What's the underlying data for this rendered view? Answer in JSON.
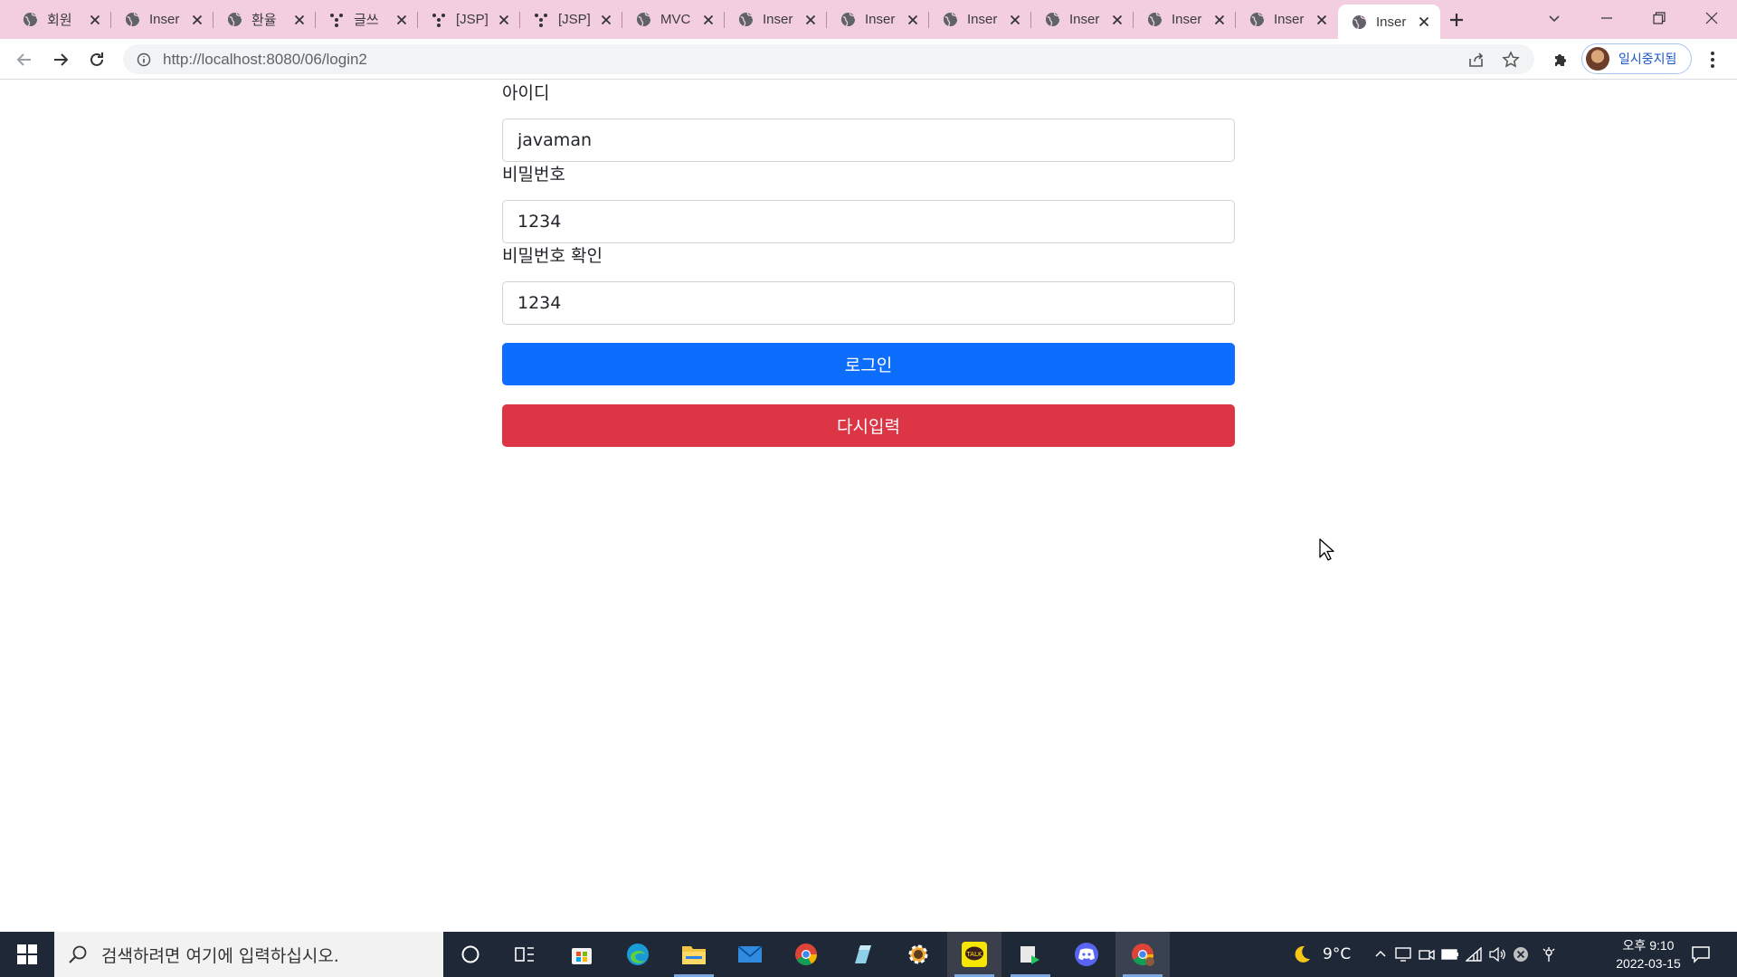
{
  "browser": {
    "tabs": [
      {
        "title": "회원",
        "icon": "globe-icon"
      },
      {
        "title": "Inser",
        "icon": "globe-icon"
      },
      {
        "title": "환율",
        "icon": "globe-icon"
      },
      {
        "title": "글쓰",
        "icon": "dots-icon"
      },
      {
        "title": "[JSP]",
        "icon": "dots-icon"
      },
      {
        "title": "[JSP]",
        "icon": "dots-icon"
      },
      {
        "title": "MVC",
        "icon": "globe-icon"
      },
      {
        "title": "Inser",
        "icon": "globe-icon"
      },
      {
        "title": "Inser",
        "icon": "globe-icon"
      },
      {
        "title": "Inser",
        "icon": "globe-icon"
      },
      {
        "title": "Inser",
        "icon": "globe-icon"
      },
      {
        "title": "Inser",
        "icon": "globe-icon"
      },
      {
        "title": "Inser",
        "icon": "globe-icon"
      },
      {
        "title": "Inser",
        "icon": "globe-icon"
      }
    ],
    "active_tab_index": 13,
    "url": "http://localhost:8080/06/login2",
    "profile_label": "일시중지됨"
  },
  "form": {
    "id_label": "아이디",
    "id_value": "javaman",
    "password_label": "비밀번호",
    "password_value": "1234",
    "password_confirm_label": "비밀번호 확인",
    "password_confirm_value": "1234",
    "login_button": "로그인",
    "reset_button": "다시입력"
  },
  "taskbar": {
    "search_placeholder": "검색하려면 여기에 입력하십시오.",
    "weather": "9°C",
    "time": "오후 9:10",
    "date": "2022-03-15"
  },
  "colors": {
    "tabstrip": "#f3cde0",
    "primary": "#0d6efd",
    "danger": "#dc3545",
    "taskbar": "#1f2837"
  }
}
